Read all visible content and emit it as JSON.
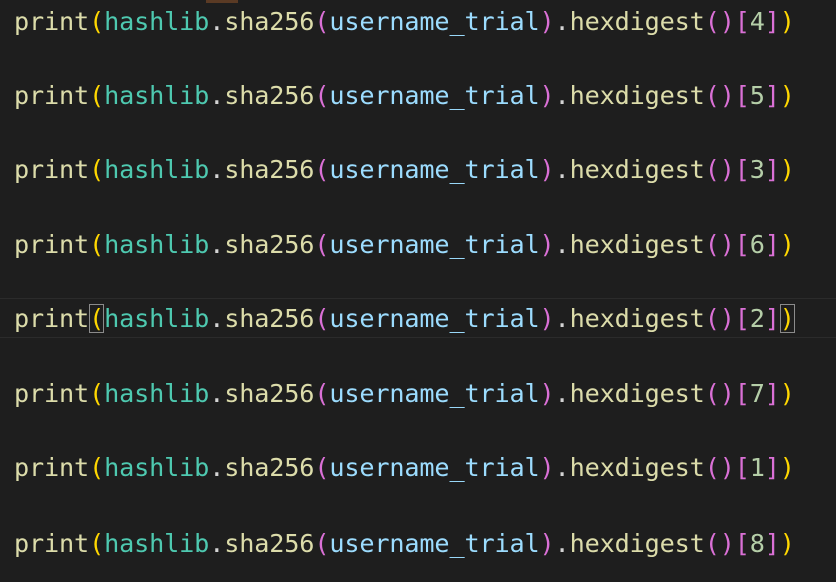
{
  "code": {
    "lines": [
      {
        "fn": "print",
        "module": "hashlib",
        "method": "sha256",
        "arg": "username_trial",
        "call": "hexdigest",
        "index": "4"
      },
      {
        "fn": "print",
        "module": "hashlib",
        "method": "sha256",
        "arg": "username_trial",
        "call": "hexdigest",
        "index": "5"
      },
      {
        "fn": "print",
        "module": "hashlib",
        "method": "sha256",
        "arg": "username_trial",
        "call": "hexdigest",
        "index": "3"
      },
      {
        "fn": "print",
        "module": "hashlib",
        "method": "sha256",
        "arg": "username_trial",
        "call": "hexdigest",
        "index": "6"
      },
      {
        "fn": "print",
        "module": "hashlib",
        "method": "sha256",
        "arg": "username_trial",
        "call": "hexdigest",
        "index": "2"
      },
      {
        "fn": "print",
        "module": "hashlib",
        "method": "sha256",
        "arg": "username_trial",
        "call": "hexdigest",
        "index": "7"
      },
      {
        "fn": "print",
        "module": "hashlib",
        "method": "sha256",
        "arg": "username_trial",
        "call": "hexdigest",
        "index": "1"
      },
      {
        "fn": "print",
        "module": "hashlib",
        "method": "sha256",
        "arg": "username_trial",
        "call": "hexdigest",
        "index": "8"
      }
    ]
  },
  "colors": {
    "background": "#1e1e1e",
    "function": "#dcdcaa",
    "class": "#4ec9b0",
    "variable": "#9cdcfe",
    "bracket_level_1": "#ffd700",
    "bracket_level_2": "#da70d6",
    "bracket_level_3": "#179fff"
  }
}
